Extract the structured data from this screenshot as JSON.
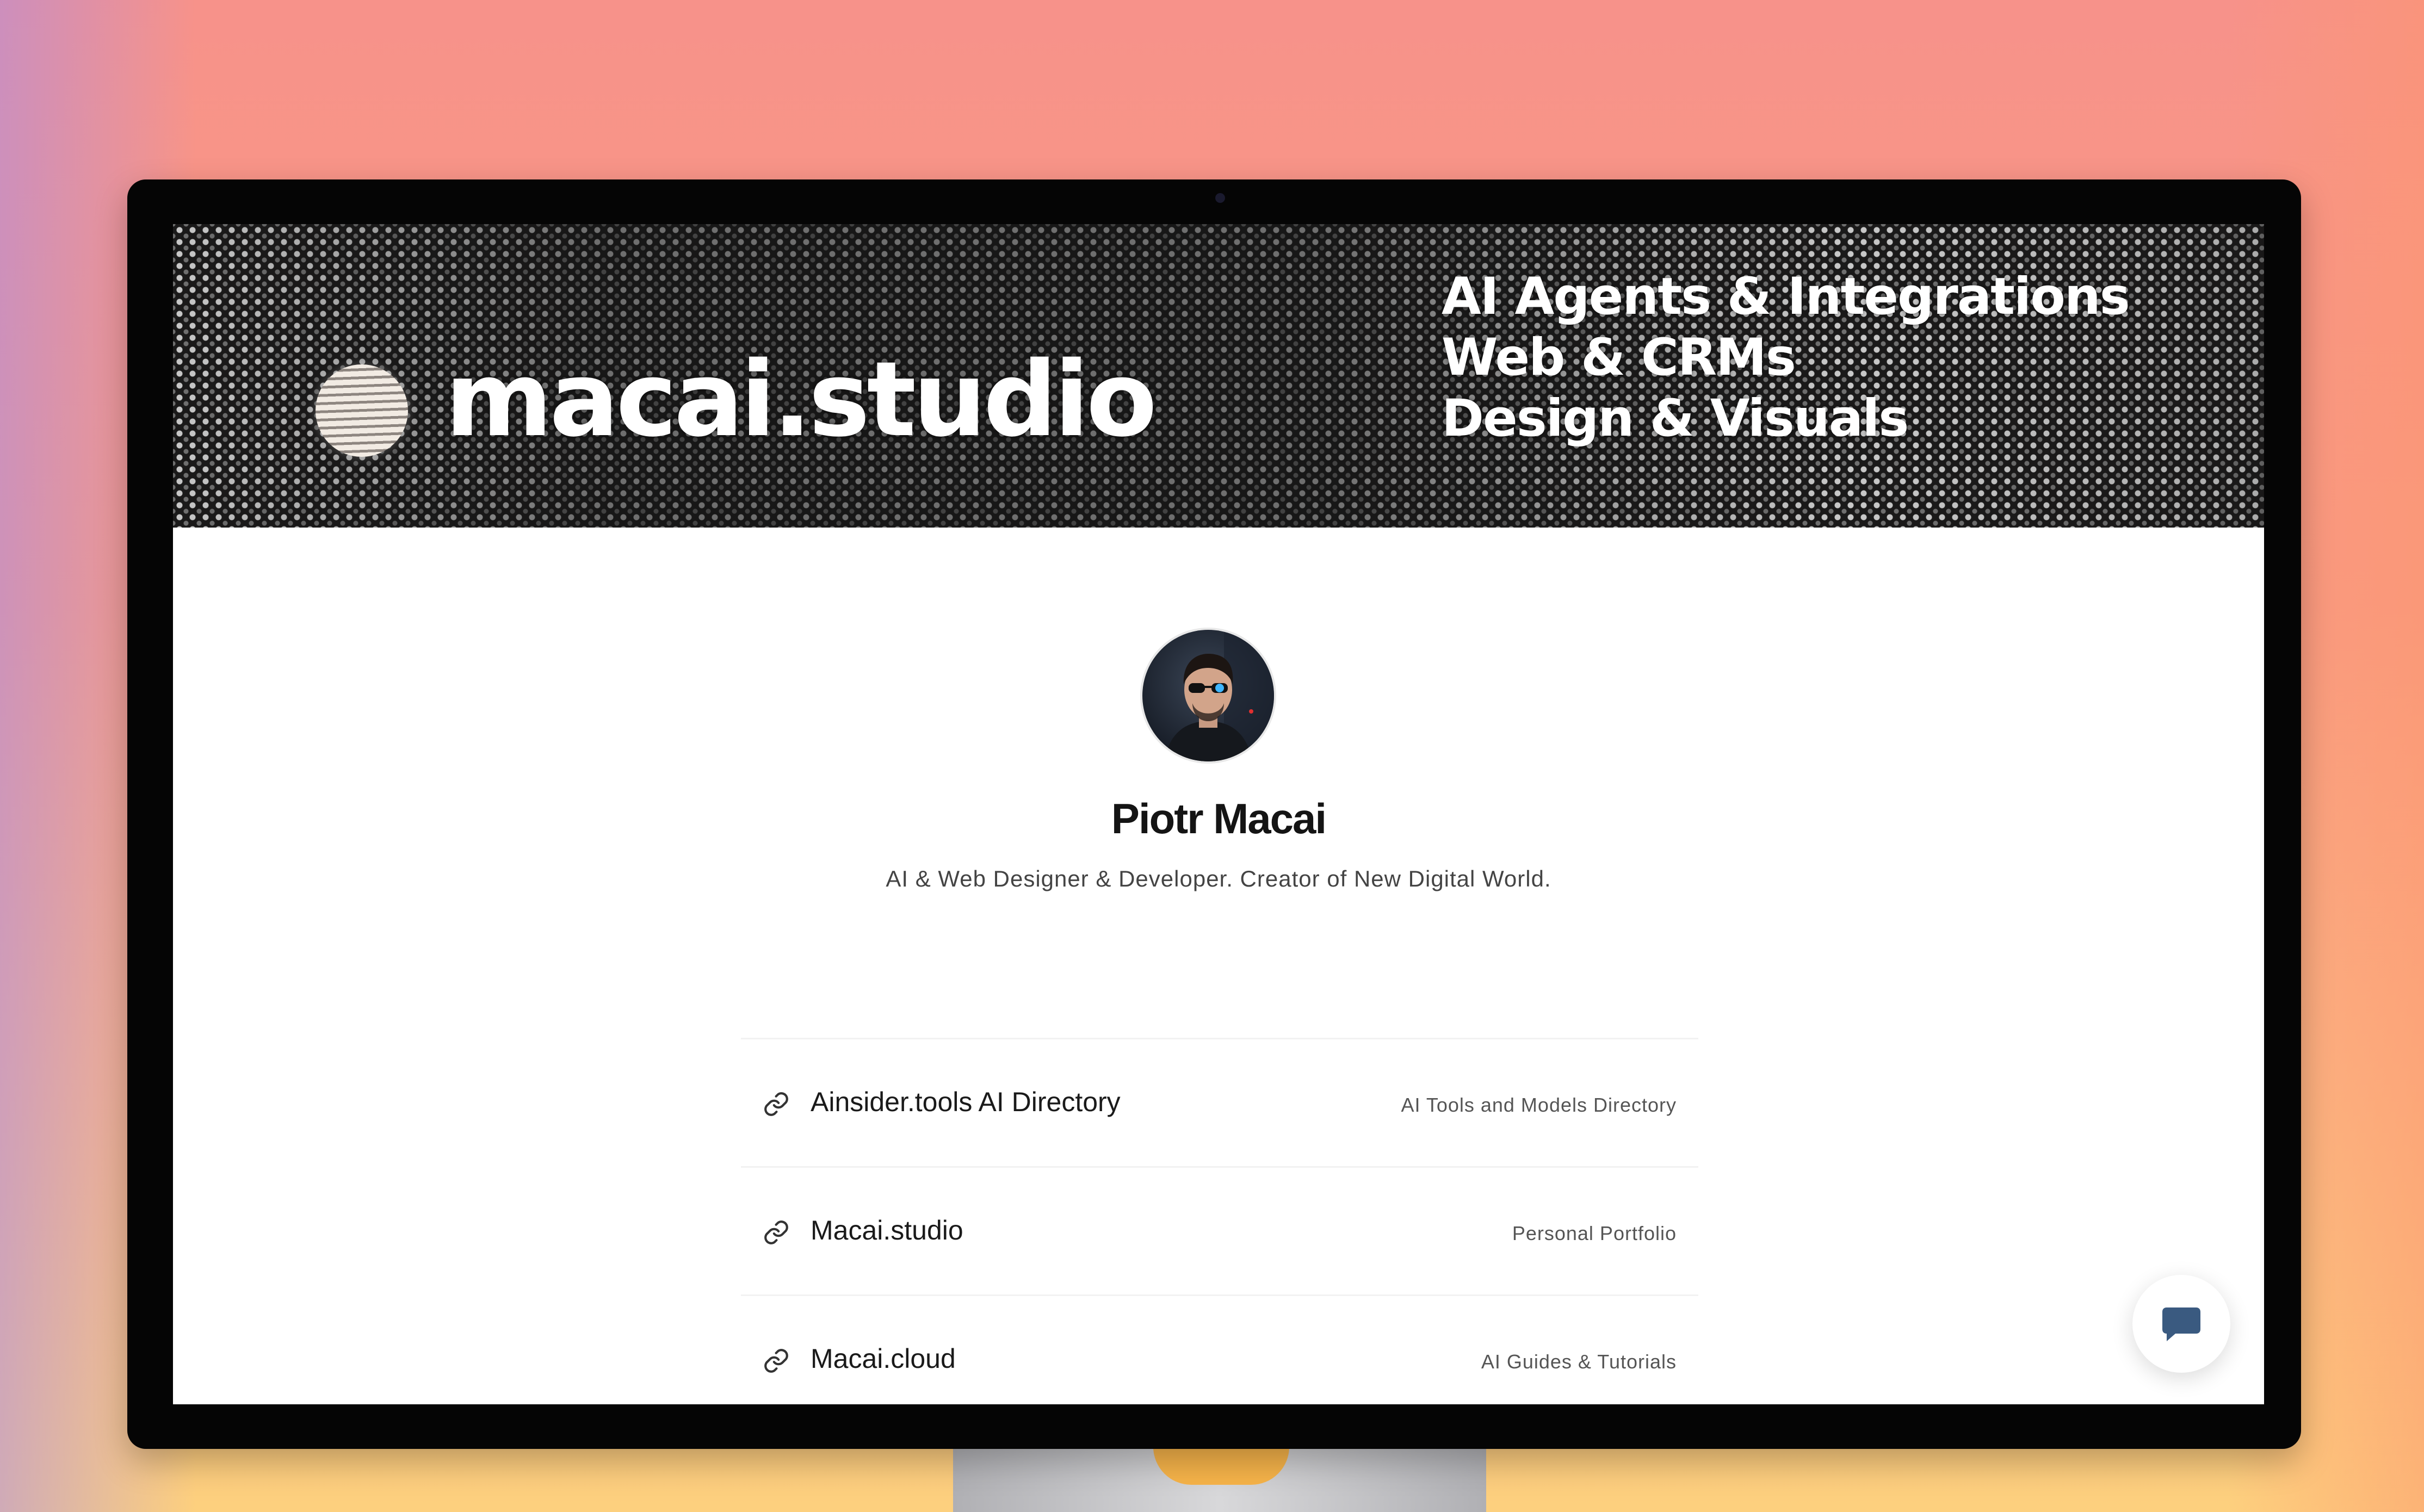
{
  "banner": {
    "brand": "macai.studio",
    "taglines": [
      "AI  Agents & Integrations",
      "Web & CRMs",
      "Design & Visuals"
    ]
  },
  "profile": {
    "name": "Piotr Macai",
    "bio": "AI & Web Designer & Developer. Creator of New Digital World."
  },
  "links": [
    {
      "title": "Ainsider.tools AI Directory",
      "description": "AI Tools and Models Directory",
      "icon": "link-icon"
    },
    {
      "title": "Macai.studio",
      "description": "Personal Portfolio",
      "icon": "link-icon"
    },
    {
      "title": "Macai.cloud",
      "description": "AI Guides & Tutorials",
      "icon": "link-icon"
    }
  ],
  "chat": {
    "icon": "chat-icon",
    "color": "#3a5a80"
  },
  "colors": {
    "background_top": "#f7928a",
    "background_bottom": "#fdd07e",
    "banner": "#1b1a1a",
    "text_primary": "#141414"
  }
}
